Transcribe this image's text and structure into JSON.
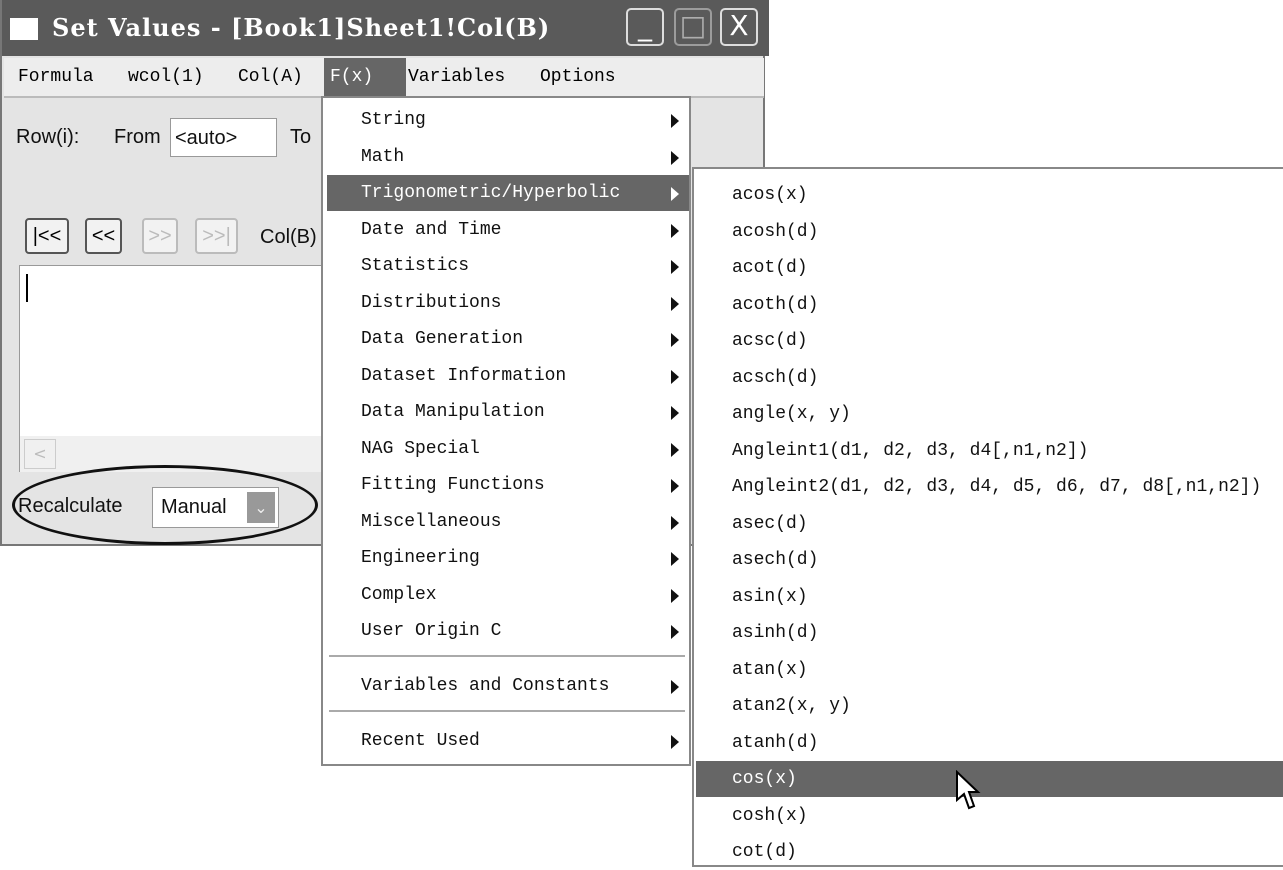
{
  "window": {
    "title": "Set Values - [Book1]Sheet1!Col(B)",
    "minimize": "_",
    "maximize": "□",
    "close": "X"
  },
  "menubar": [
    "Formula",
    "wcol(1)",
    "Col(A)",
    "F(x)",
    "Variables",
    "Options"
  ],
  "row": {
    "label": "Row(i):",
    "from_label": "From",
    "from_value": "<auto>",
    "to_label": "To"
  },
  "nav": {
    "first": "|<<",
    "prev": "<<",
    "next": ">>",
    "last": ">>|",
    "col_label": "Col(B)"
  },
  "recalculate": {
    "label": "Recalculate",
    "value": "Manual"
  },
  "fx_menu": {
    "items": [
      "String",
      "Math",
      "Trigonometric/Hyperbolic",
      "Date and Time",
      "Statistics",
      "Distributions",
      "Data Generation",
      "Dataset Information",
      "Data Manipulation",
      "NAG Special",
      "Fitting Functions",
      "Miscellaneous",
      "Engineering",
      "Complex",
      "User Origin C"
    ],
    "extra": [
      "Variables and Constants",
      "Recent Used"
    ],
    "selected": "Trigonometric/Hyperbolic"
  },
  "submenu": {
    "items": [
      "acos(x)",
      "acosh(d)",
      "acot(d)",
      "acoth(d)",
      "acsc(d)",
      "acsch(d)",
      "angle(x, y)",
      "Angleint1(d1, d2, d3, d4[,n1,n2])",
      "Angleint2(d1, d2, d3, d4, d5, d6, d7, d8[,n1,n2])",
      "asec(d)",
      "asech(d)",
      "asin(x)",
      "asinh(d)",
      "atan(x)",
      "atan2(x, y)",
      "atanh(d)",
      "cos(x)",
      "cosh(x)",
      "cot(d)"
    ],
    "selected": "cos(x)"
  },
  "colors": {
    "highlight": "#666666",
    "titlebar": "#5a5a5a"
  }
}
